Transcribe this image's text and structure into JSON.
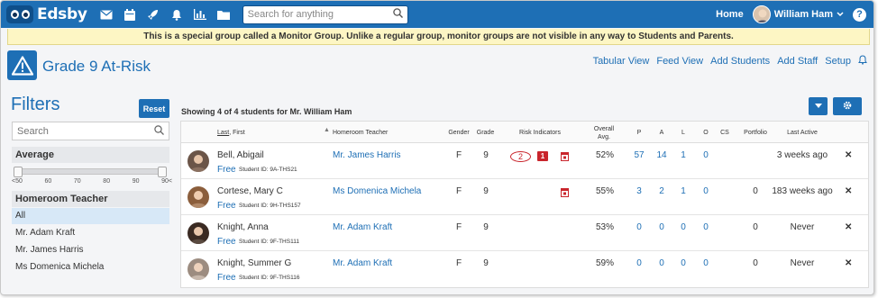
{
  "app": {
    "logo_text": "Edsby"
  },
  "topbar": {
    "search_placeholder": "Search for anything",
    "home_label": "Home",
    "user_name": "William Ham",
    "help_label": "?"
  },
  "notice": "This is a special group called a Monitor Group. Unlike a regular group, monitor groups are not visible in any way to Students and Parents.",
  "group": {
    "title": "Grade 9 At-Risk",
    "links": [
      "Tabular View",
      "Feed View",
      "Add Students",
      "Add Staff",
      "Setup"
    ]
  },
  "filters": {
    "title": "Filters",
    "reset_label": "Reset",
    "search_placeholder": "Search",
    "average_label": "Average",
    "ticks": [
      "<50",
      "60",
      "70",
      "80",
      "90",
      "90<"
    ],
    "homeroom_label": "Homeroom Teacher",
    "homeroom_items": [
      "All",
      "Mr. Adam Kraft",
      "Mr. James Harris",
      "Ms Domenica Michela"
    ]
  },
  "main": {
    "showing": "Showing 4 of 4 students for Mr. William Ham",
    "columns": {
      "last": "Last",
      "first": ", First",
      "homeroom": "Homeroom Teacher",
      "gender": "Gender",
      "grade": "Grade",
      "risk": "Risk Indicators",
      "overall_1": "Overall",
      "overall_2": "Avg.",
      "p": "P",
      "a": "A",
      "l": "L",
      "o": "O",
      "cs": "CS",
      "portfolio": "Portfolio",
      "last_active": "Last Active"
    },
    "rows": [
      {
        "name": "Bell, Abigail",
        "status": "Free",
        "student_id": "Student ID: 9A-THS21",
        "teacher": "Mr. James Harris",
        "gender": "F",
        "grade": "9",
        "risk_circle": "2",
        "risk_badge": "1",
        "overall": "52%",
        "p": "57",
        "a": "14",
        "l": "1",
        "o": "0",
        "cs": "",
        "portfolio": "",
        "last_active": "3 weeks ago",
        "close": "✕"
      },
      {
        "name": "Cortese, Mary C",
        "status": "Free",
        "student_id": "Student ID: 9H-THS157",
        "teacher": "Ms Domenica Michela",
        "gender": "F",
        "grade": "9",
        "overall": "55%",
        "p": "3",
        "a": "2",
        "l": "1",
        "o": "0",
        "cs": "",
        "portfolio": "0",
        "last_active": "183 weeks ago",
        "close": "✕"
      },
      {
        "name": "Knight, Anna",
        "status": "Free",
        "student_id": "Student ID: 9F-THS111",
        "teacher": "Mr. Adam Kraft",
        "gender": "F",
        "grade": "9",
        "overall": "53%",
        "p": "0",
        "a": "0",
        "l": "0",
        "o": "0",
        "cs": "",
        "portfolio": "0",
        "last_active": "Never",
        "close": "✕"
      },
      {
        "name": "Knight, Summer G",
        "status": "Free",
        "student_id": "Student ID: 9F-THS116",
        "teacher": "Mr. Adam Kraft",
        "gender": "F",
        "grade": "9",
        "overall": "59%",
        "p": "0",
        "a": "0",
        "l": "0",
        "o": "0",
        "cs": "",
        "portfolio": "0",
        "last_active": "Never",
        "close": "✕"
      }
    ]
  },
  "colors": {
    "brand": "#1e6fb5",
    "notice_bg": "#fdf6c4",
    "risk_red": "#c9252c"
  }
}
